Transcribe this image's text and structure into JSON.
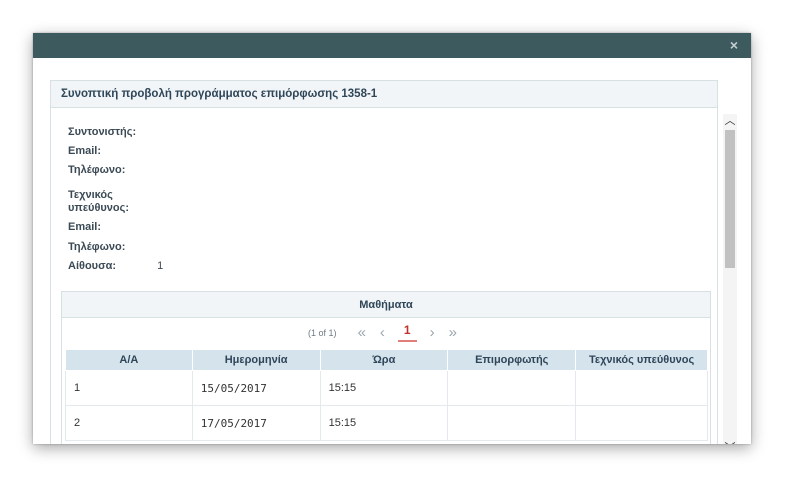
{
  "dialog": {
    "close_glyph": "×",
    "panel_title": "Συνοπτική προβολή προγράμματος επιμόρφωσης 1358-1"
  },
  "info": {
    "coordinator_label": "Συντονιστής:",
    "email_label_1": "Email:",
    "phone_label_1": "Τηλέφωνο:",
    "tech_manager_label_line1": "Τεχνικός",
    "tech_manager_label_line2": "υπεύθυνος:",
    "email_label_2": "Email:",
    "phone_label_2": "Τηλέφωνο:",
    "room_label": "Αίθουσα:",
    "room_value": "1"
  },
  "lessons": {
    "title": "Μαθήματα",
    "pager": {
      "report": "(1 of 1)",
      "first": "«",
      "prev": "‹",
      "page": "1",
      "next": "›",
      "last": "»"
    },
    "columns": [
      "Α/Α",
      "Ημερομηνία",
      "Ώρα",
      "Επιμορφωτής",
      "Τεχνικός υπεύθυνος"
    ],
    "rows": [
      {
        "aa": "1",
        "date": "15/05/2017",
        "time": "15:15",
        "trainer": "",
        "tech": ""
      },
      {
        "aa": "2",
        "date": "17/05/2017",
        "time": "15:15",
        "trainer": "",
        "tech": ""
      }
    ]
  },
  "scrollbar": {
    "up_glyph": "︿",
    "down_glyph": "﹀"
  },
  "icons": {
    "close": "close-icon",
    "first_page": "double-chevron-left-icon",
    "prev_page": "chevron-left-icon",
    "next_page": "chevron-right-icon",
    "last_page": "double-chevron-right-icon",
    "scroll_up": "chevron-up-icon",
    "scroll_down": "chevron-down-icon"
  },
  "colors": {
    "header": "#3d5a5e",
    "panel_heading_bg": "#f1f5f7",
    "table_header_bg": "#d5e3ec",
    "active_page": "#c0312b"
  }
}
